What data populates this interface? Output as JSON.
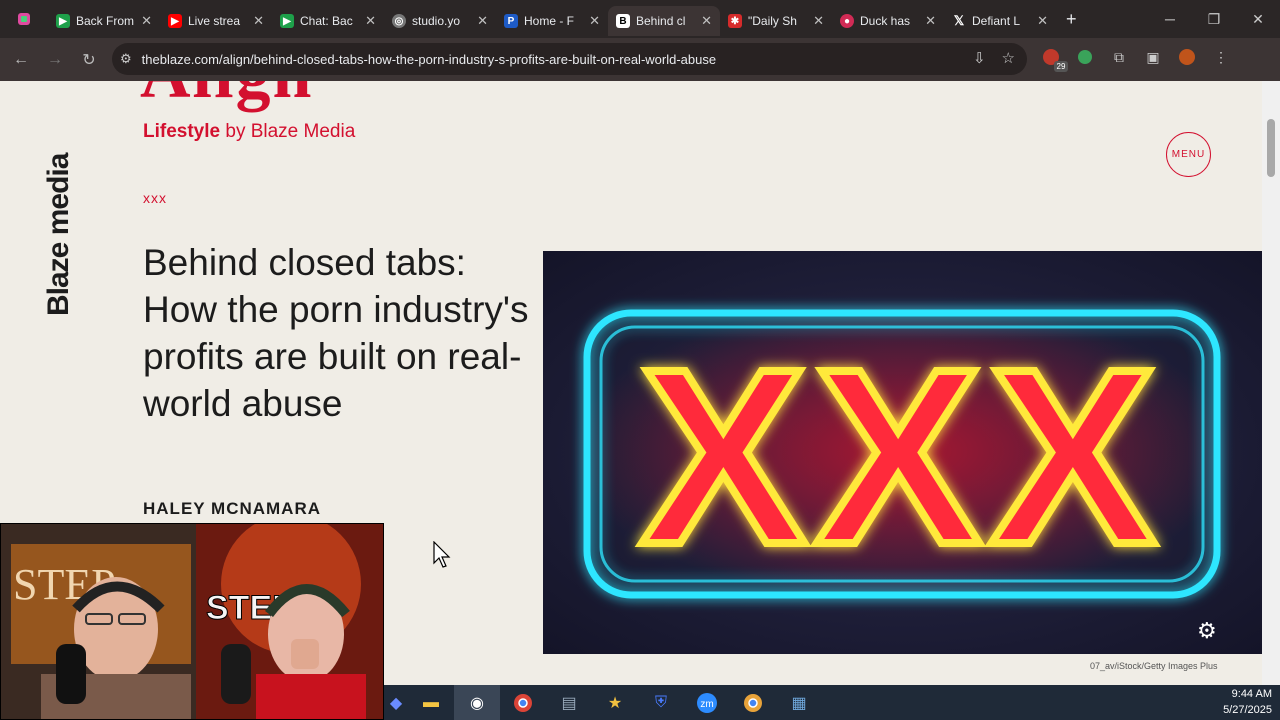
{
  "browser": {
    "tabs": [
      {
        "title": "Back From",
        "favicon_color": "#1ea04a",
        "favicon": "play-icon"
      },
      {
        "title": "Live strea",
        "favicon_color": "#ff0000",
        "favicon": "youtube-icon"
      },
      {
        "title": "Chat: Bac",
        "favicon_color": "#1ea04a",
        "favicon": "play-icon"
      },
      {
        "title": "studio.yo",
        "favicon_color": "#888888",
        "favicon": "globe-icon"
      },
      {
        "title": "Home - F",
        "favicon_color": "#1e5bc6",
        "favicon": "paypal-icon"
      },
      {
        "title": "Behind cl",
        "favicon_color": "#ffffff",
        "favicon": "blaze-icon",
        "active": true
      },
      {
        "title": "\"Daily Sh",
        "favicon_color": "#d62b2b",
        "favicon": "flag-icon"
      },
      {
        "title": "Duck has",
        "favicon_color": "#d12b55",
        "favicon": "duck-icon"
      },
      {
        "title": "Defiant L",
        "favicon_color": "#ffffff",
        "favicon": "x-icon"
      }
    ],
    "close_glyph": "✕",
    "new_tab_glyph": "+",
    "url": "theblaze.com/align/behind-closed-tabs-how-the-porn-industry-s-profits-are-built-on-real-world-abuse",
    "extension_badge": "29"
  },
  "page": {
    "brand": "Blaze media",
    "logo_partial": "Align",
    "category_bold": "Lifestyle",
    "category_rest": " by Blaze Media",
    "menu_label": "MENU",
    "tag": "xxx",
    "headline": "Behind closed tabs: How the porn industry's profits are built on real-world abuse",
    "author": "HALEY MCNAMARA",
    "hero_text": "XXX",
    "image_credit": "07_av/iStock/Getty Images Plus"
  },
  "overlay": {
    "sign_text": "STEP"
  },
  "taskbar": {
    "time": "9:44 AM",
    "date": "5/27/2025"
  },
  "colors": {
    "accent": "#d3102f",
    "page_bg": "#f0ede6",
    "tabbar_bg": "#2b2626",
    "neon_cyan": "#2ee6ff",
    "neon_red": "#ff2a3a",
    "neon_yellow": "#ffe93a"
  }
}
